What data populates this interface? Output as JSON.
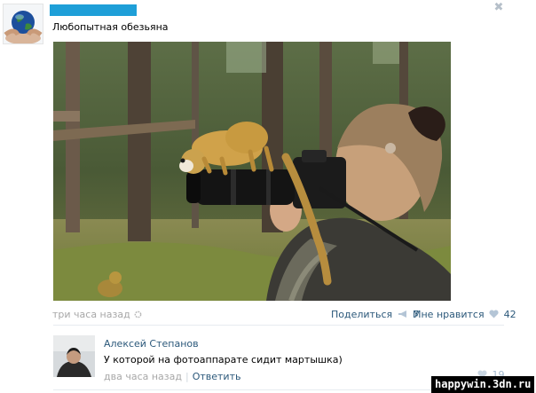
{
  "post": {
    "text": "Любопытная обезьяна",
    "time": "три часа назад",
    "share_label": "Поделиться",
    "share_count": "7",
    "like_label": "Мне нравится",
    "like_count": "42"
  },
  "comment": {
    "author": "Алексей Степанов",
    "text": "У которой на фотоаппарате сидит мартышка)",
    "time": "два часа назад",
    "separator": "|",
    "reply_label": "Ответить",
    "like_count": "19"
  },
  "close_glyph": "✖",
  "watermark": "happywin.3dn.ru",
  "colors": {
    "link": "#2b587a",
    "muted": "#a7a7a7",
    "redaction": "#1e9fd8",
    "divider": "#e7ebf0"
  }
}
